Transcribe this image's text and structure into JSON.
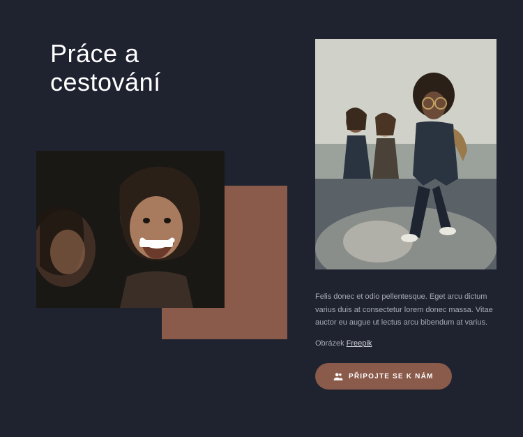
{
  "heading": "Práce a\ncestování",
  "body_text": "Felis donec et odio pellentesque. Eget arcu dictum varius duis at consectetur lorem donec massa. Vitae auctor eu augue ut lectus arcu bibendum at varius.",
  "credit": {
    "prefix": "Obrázek ",
    "link_text": "Freepik"
  },
  "cta": {
    "label": "PŘIPOJTE SE K NÁM",
    "icon": "people-icon"
  },
  "colors": {
    "background": "#1f2330",
    "accent": "#8a5a4a",
    "text_muted": "#a8abb5"
  },
  "images": {
    "left_alt": "Smiling woman with curly hair",
    "right_alt": "Group of people sitting on rocks outdoors"
  }
}
